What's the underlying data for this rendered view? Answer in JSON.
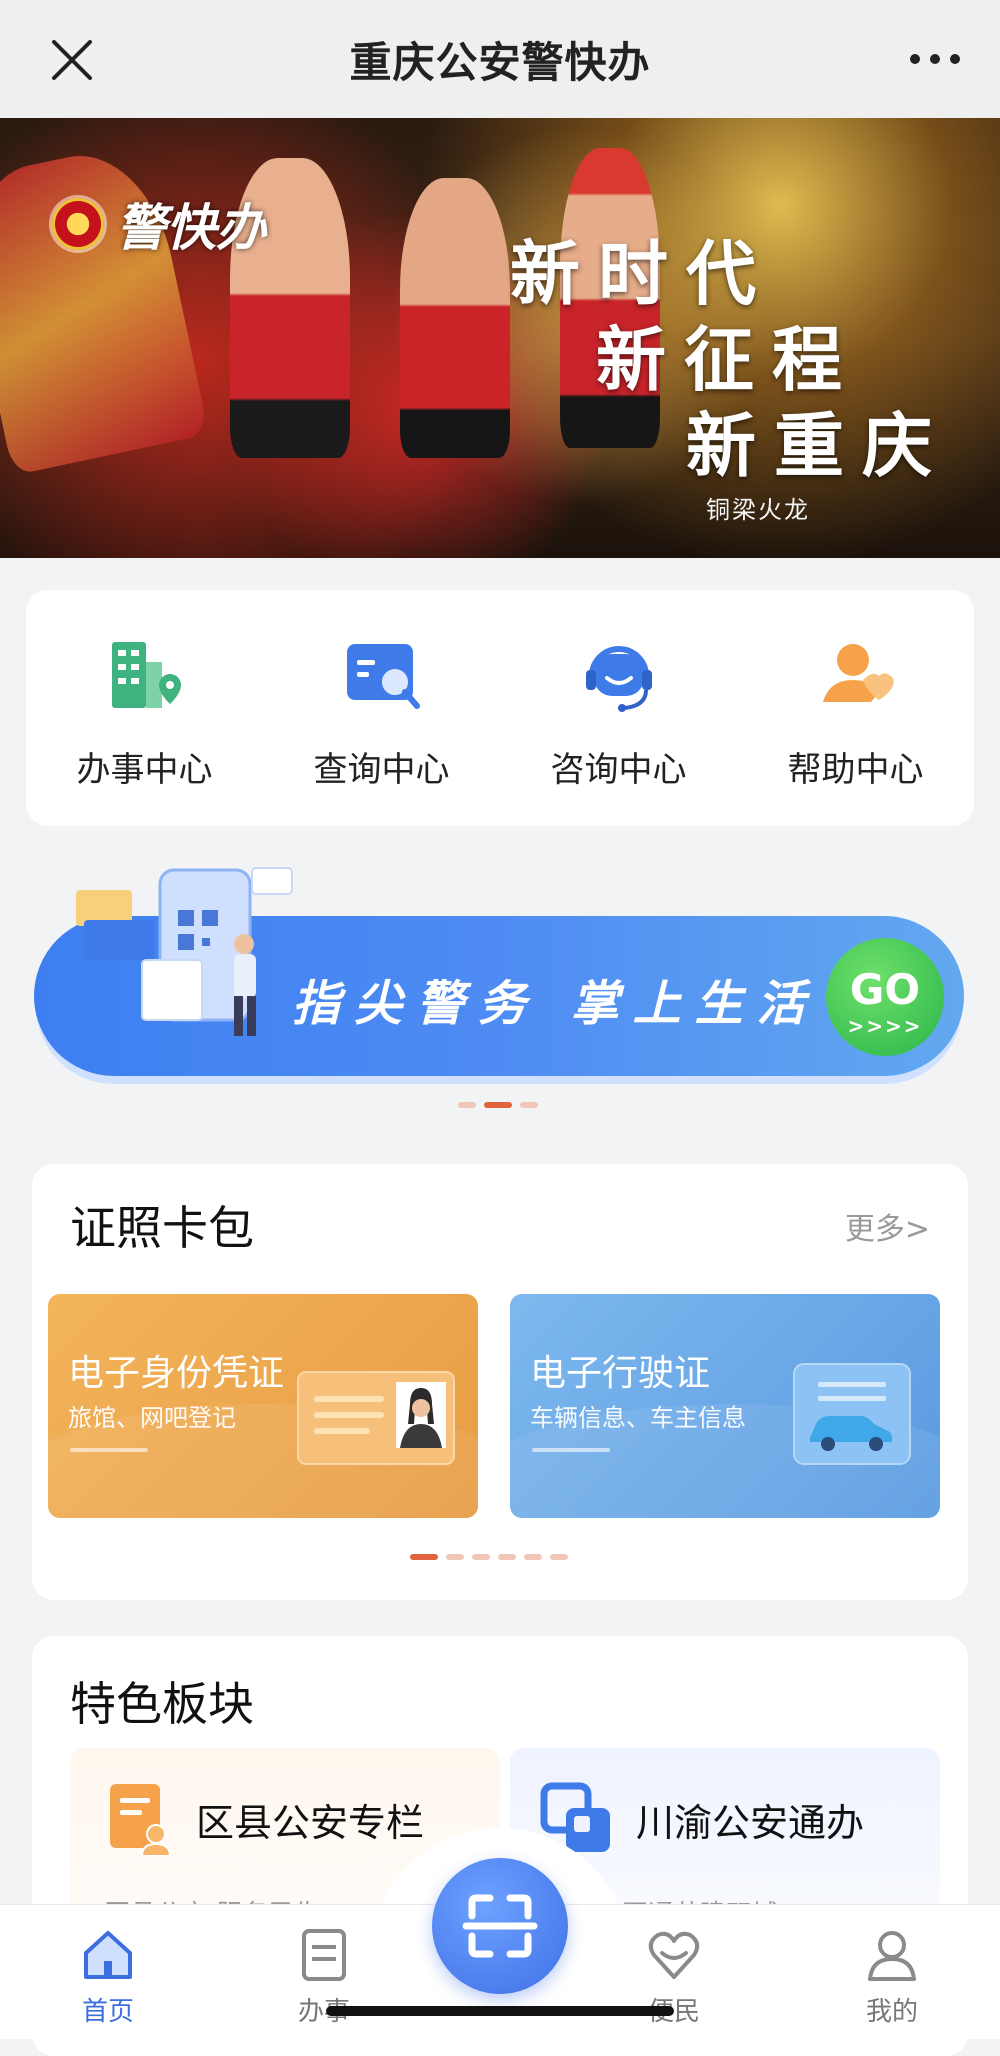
{
  "header": {
    "title": "重庆公安警快办",
    "close_icon": "close-icon",
    "more_icon": "more-icon"
  },
  "hero": {
    "logo_text": "警快办",
    "slogan_lines": [
      "新时代",
      "新征程",
      "新重庆"
    ],
    "caption": "铜梁火龙"
  },
  "services": [
    {
      "label": "办事中心",
      "icon": "building-location-icon",
      "color": "#3fb37f"
    },
    {
      "label": "查询中心",
      "icon": "search-document-icon",
      "color": "#3f7be8"
    },
    {
      "label": "咨询中心",
      "icon": "headset-icon",
      "color": "#3f7be8"
    },
    {
      "label": "帮助中心",
      "icon": "helping-hand-icon",
      "color": "#f5a24a"
    }
  ],
  "promo": {
    "text": "指尖警务 掌上生活",
    "go_label": "GO",
    "go_arrows": ">>>>"
  },
  "wallet": {
    "title": "证照卡包",
    "more": "更多>",
    "cards": [
      {
        "name": "电子身份凭证",
        "sub": "旅馆、网吧登记",
        "theme": "orange"
      },
      {
        "name": "电子行驶证",
        "sub": "车辆信息、车主信息",
        "theme": "blue"
      }
    ]
  },
  "features": {
    "title": "特色板块",
    "items": [
      {
        "name": "区县公安专栏",
        "desc": "区县公安 服务民生",
        "icon": "district-document-icon"
      },
      {
        "name": "川渝公安通办",
        "desc": "渝公安互通共建双城…",
        "icon": "linked-squares-icon"
      }
    ]
  },
  "bottom_nav": {
    "items": [
      {
        "label": "首页",
        "icon": "home-icon",
        "active": true
      },
      {
        "label": "办事",
        "icon": "document-icon",
        "active": false
      },
      {
        "label": "便民",
        "icon": "heart-icon",
        "active": false
      },
      {
        "label": "我的",
        "icon": "user-icon",
        "active": false
      }
    ],
    "scan_icon": "scan-icon"
  },
  "colors": {
    "accent": "#3d6ee0",
    "orange": "#e79c43",
    "blue": "#5a9ae0",
    "go_green": "#29b54a"
  }
}
